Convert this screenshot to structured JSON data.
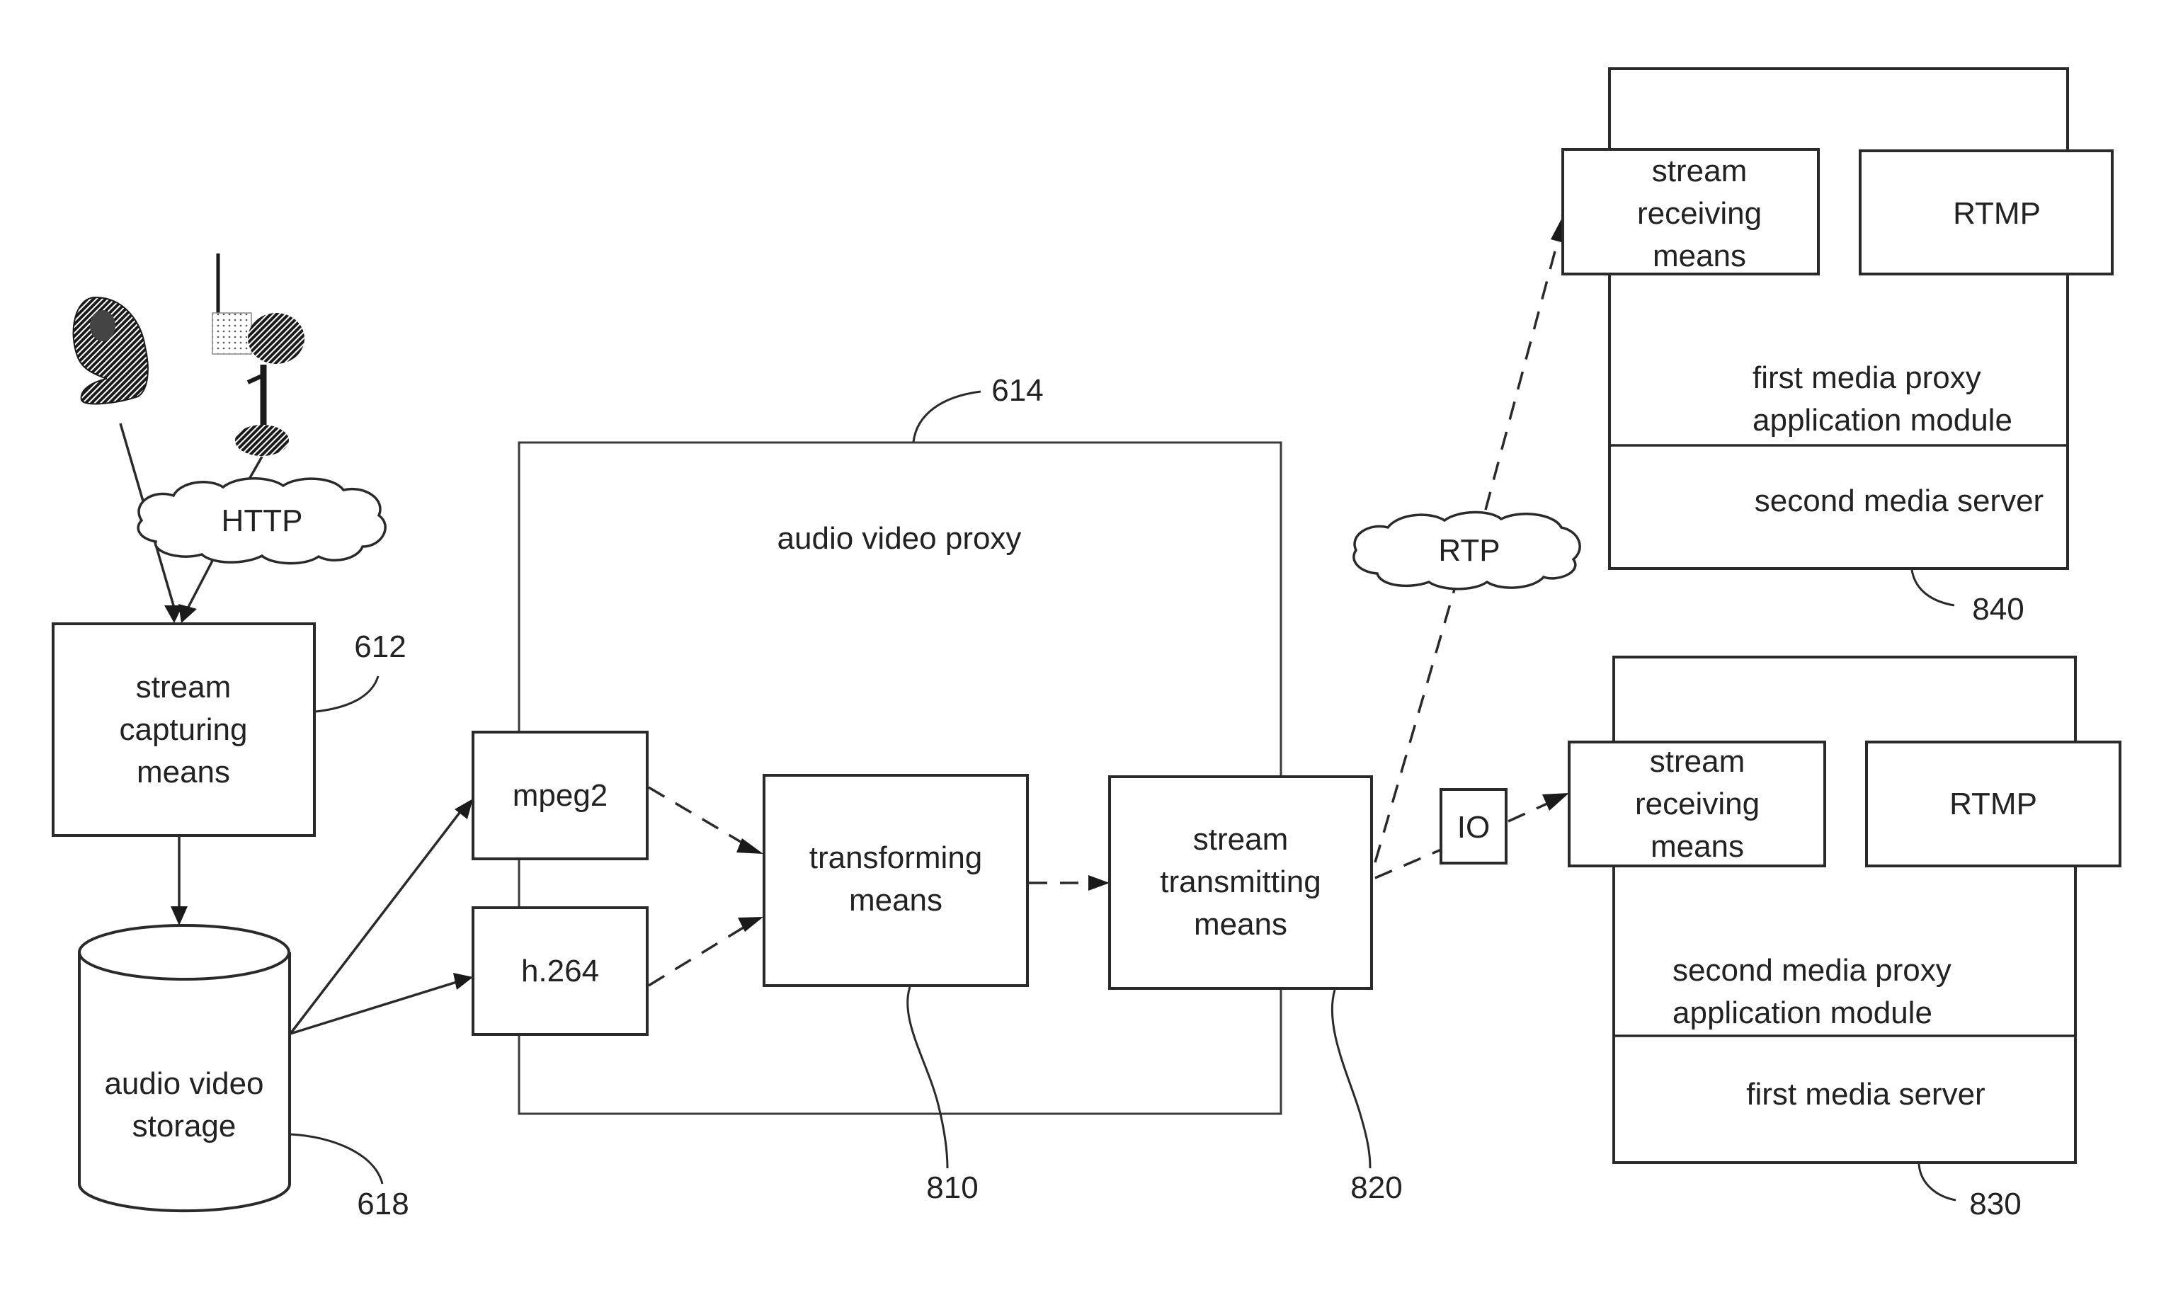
{
  "figure": {
    "sources": {
      "webcam": "webcam-icon",
      "ip_camera": "ip-camera-icon",
      "http_cloud": "HTTP"
    },
    "stream_capturing": {
      "lines": [
        "stream",
        "capturing",
        "means"
      ],
      "ref": "612"
    },
    "storage": {
      "lines": [
        "audio video",
        "storage"
      ],
      "ref": "618"
    },
    "proxy": {
      "title": "audio video proxy",
      "ref": "614",
      "codecs": [
        "mpeg2",
        "h.264"
      ],
      "transforming": {
        "lines": [
          "transforming",
          "means"
        ],
        "ref": "810"
      },
      "transmitting": {
        "lines": [
          "stream",
          "transmitting",
          "means"
        ],
        "ref": "820"
      }
    },
    "rtp_cloud": "RTP",
    "io_box": "IO",
    "server_840": {
      "ref": "840",
      "receiving": [
        "stream",
        "receiving",
        "means"
      ],
      "protocol": "RTMP",
      "module_lines": [
        "first media proxy",
        "application module"
      ],
      "server_label": "second media server"
    },
    "server_830": {
      "ref": "830",
      "receiving": [
        "stream",
        "receiving",
        "means"
      ],
      "protocol": "RTMP",
      "module_lines": [
        "second media proxy",
        "application module"
      ],
      "server_label": "first media server"
    }
  }
}
